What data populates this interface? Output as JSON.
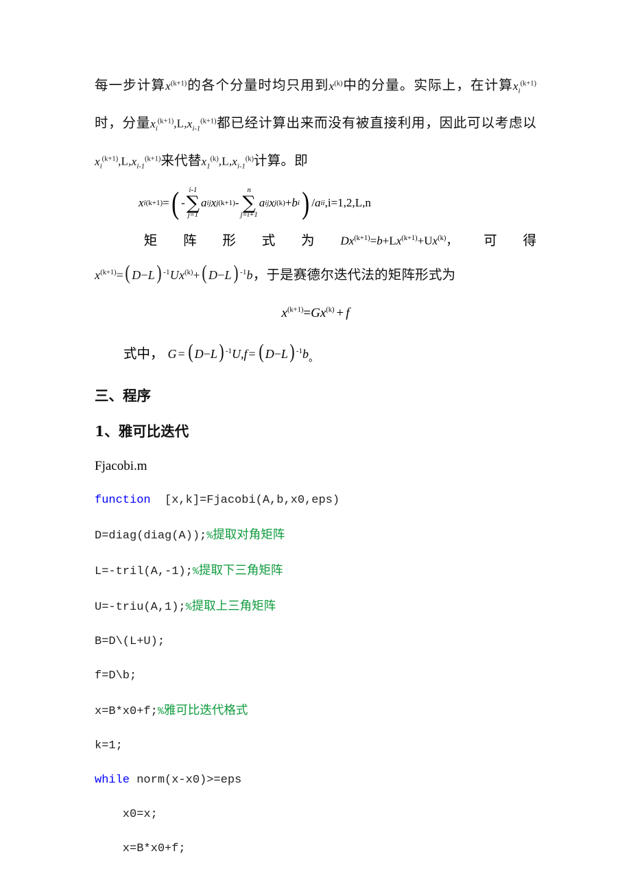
{
  "document": {
    "kind": "lecture-notes",
    "language": "zh-CN",
    "colors": {
      "text": "#111111",
      "keyword": "#0000FF",
      "comment": "#0F9B3E",
      "background": "#FFFFFF"
    }
  },
  "paragraph1": {
    "seg1": "每一步计算",
    "math1": {
      "base": "x",
      "sup": "(k+1)"
    },
    "seg2": "的各个分量时均只用到",
    "math2": {
      "base": "x",
      "sup": "(k)"
    },
    "seg3": "中的分量。实际上，在计算",
    "math3": {
      "base": "x",
      "sub": "i",
      "sup": "(k+1)"
    },
    "seg4": "时，分量",
    "math4": {
      "base": "x",
      "sub": "i",
      "sup": "(k+1)"
    },
    "sep1": ",",
    "ell1": "L",
    "sep2": ",",
    "math5": {
      "base": "x",
      "sub": "i-1",
      "sup": "(k+1)"
    },
    "seg5": "都已经计算出来而没有被直接利用，因此可以考虑以",
    "math6": {
      "base": "x",
      "sub": "i",
      "sup": "(k+1)"
    },
    "sep3": ",",
    "ell2": "L",
    "sep4": ",",
    "math7": {
      "base": "x",
      "sub": "i-1",
      "sup": "(k+1)"
    },
    "seg6": "来代替",
    "math8": {
      "base": "x",
      "sub": "1",
      "sup": "(k)"
    },
    "sep5": ",",
    "ell3": "L",
    "sep6": ",",
    "math9": {
      "base": "x",
      "sub": "i-1",
      "sup": "(k)"
    },
    "seg7": "计算。即"
  },
  "equation_main": {
    "lhs_base": "x",
    "lhs_sub": "i",
    "lhs_sup": "(k+1)",
    "equals": "=",
    "open_paren": "(",
    "minus1": "-",
    "sum1": {
      "upper": "i-1",
      "symbol": "∑",
      "lower": "j=1"
    },
    "term1": {
      "a": "a",
      "a_sub": "ij",
      "x": "x",
      "x_sub": "j",
      "x_sup": "(k+1)"
    },
    "minus2": "-",
    "sum2": {
      "upper": "n",
      "symbol": "∑",
      "lower": "j=i+1"
    },
    "term2": {
      "a": "a",
      "a_sub": "ij",
      "x": "x",
      "x_sub": "j",
      "x_sup": "(k)"
    },
    "plus": "+",
    "b": "b",
    "b_sub": "i",
    "close_paren": ")",
    "divider": "/",
    "denom": "a",
    "denom_sub": "ii",
    "tail": ",i=1,2,",
    "tail_ell": "L",
    "tail_end": ",n"
  },
  "spread_line": {
    "words": [
      "矩",
      "阵",
      "形",
      "式",
      "为"
    ],
    "equation": {
      "D": "D",
      "x1": "x",
      "x1_sup": "(k+1)",
      "eq": "=",
      "b": "b",
      "plus1": "+",
      "L": "L",
      "x2": "x",
      "x2_sup": "(k+1)",
      "plus2": "+",
      "U": "U",
      "x3": "x",
      "x3_sup": "(k)",
      "comma": "，"
    },
    "tail_words": [
      "可",
      "得"
    ]
  },
  "line_seidel": {
    "equation": {
      "x_base": "x",
      "x_sup": "(k+1)",
      "eq": "=",
      "open": "(",
      "D": "D",
      "minus": "−",
      "L": "L",
      "close": ")",
      "inv": "-1",
      "U": "U",
      "x2": "x",
      "x2_sup": "(k)",
      "plus": "+",
      "open2": "(",
      "D2": "D",
      "minus2": "−",
      "L2": "L",
      "close2": ")",
      "inv2": "-1",
      "b": "b"
    },
    "comma": "，",
    "text": "于是赛德尔迭代法的矩阵形式为"
  },
  "equation_gx": {
    "x_base": "x",
    "x_sup": "(k+1)",
    "eq": "=",
    "G": "G",
    "x2": "x",
    "x2_sup": "(k)",
    "plus": "+",
    "f": "f"
  },
  "line_where": {
    "label": "式中，",
    "equation": {
      "G": "G",
      "eq1": "=",
      "open": "(",
      "D": "D",
      "minus": "−",
      "L": "L",
      "close": ")",
      "inv": "-1",
      "U": "U",
      "comma": ",",
      "f": "f",
      "eq2": "=",
      "open2": "(",
      "D2": "D",
      "minus2": "−",
      "L2": "L",
      "close2": ")",
      "inv2": "-1",
      "b": "b"
    },
    "period": "。"
  },
  "headings": {
    "section": "三、程序",
    "subsection": "1、雅可比迭代",
    "filename": "Fjacobi.m"
  },
  "code": {
    "lines": [
      {
        "id": "code-line-1",
        "keyword": "function",
        "rest": "  [x,k]=Fjacobi(A,b,x0,eps)",
        "comment": "",
        "comment_pct": ""
      },
      {
        "id": "code-line-2",
        "keyword": "",
        "rest": "D=diag(diag(A));",
        "comment_pct": "%",
        "comment": "提取对角矩阵"
      },
      {
        "id": "code-line-3",
        "keyword": "",
        "rest": "L=-tril(A,-1);",
        "comment_pct": "%",
        "comment": "提取下三角矩阵"
      },
      {
        "id": "code-line-4",
        "keyword": "",
        "rest": "U=-triu(A,1);",
        "comment_pct": "%",
        "comment": "提取上三角矩阵"
      },
      {
        "id": "code-line-5",
        "keyword": "",
        "rest": "B=D\\(L+U);",
        "comment_pct": "",
        "comment": ""
      },
      {
        "id": "code-line-6",
        "keyword": "",
        "rest": "f=D\\b;",
        "comment_pct": "",
        "comment": ""
      },
      {
        "id": "code-line-7",
        "keyword": "",
        "rest": "x=B*x0+f;",
        "comment_pct": "%",
        "comment": "雅可比迭代格式"
      },
      {
        "id": "code-line-8",
        "keyword": "",
        "rest": "k=1;",
        "comment_pct": "",
        "comment": ""
      },
      {
        "id": "code-line-9",
        "keyword": "while",
        "rest": " norm(x-x0)>=eps",
        "comment_pct": "",
        "comment": ""
      },
      {
        "id": "code-line-10",
        "keyword": "",
        "rest": "    x0=x;",
        "comment_pct": "",
        "comment": ""
      },
      {
        "id": "code-line-11",
        "keyword": "",
        "rest": "    x=B*x0+f;",
        "comment_pct": "",
        "comment": ""
      }
    ]
  }
}
